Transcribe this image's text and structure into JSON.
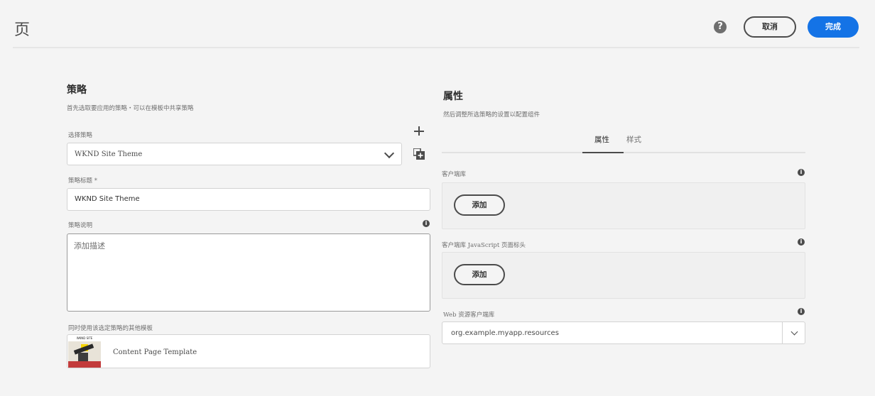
{
  "header": {
    "title": "页",
    "help_icon": "help-icon",
    "help_glyph": "?",
    "cancel_label": "取消",
    "done_label": "完成",
    "accent_color": "#1473e6"
  },
  "policy": {
    "title": "策略",
    "subtitle": "首先选取要应用的策略・可以在模板中共享策略",
    "select_label": "选择策略",
    "select_value": "WKND Site Theme",
    "policy_title_label": "策略标题 *",
    "policy_title_value": "WKND Site Theme",
    "description_label": "策略说明",
    "description_placeholder": "添加描述",
    "other_templates_label": "同时使用该选定策略的其他模板",
    "template_name": "Content Page Template",
    "thumb_text": "WKND SITE"
  },
  "properties": {
    "title": "属性",
    "subtitle": "然后调整所选策略的设置以配置组件",
    "tabs": [
      {
        "label": "属性",
        "active": true
      },
      {
        "label": "样式",
        "active": false
      }
    ],
    "client_lib_label": "客户端库",
    "client_lib_add": "添加",
    "client_lib_js_label": "客户端库 JavaScript 页面标头",
    "client_lib_js_add": "添加",
    "web_lib_label": "Web 资源客户端库",
    "web_lib_value": "org.example.myapp.resources",
    "info_glyph": "i"
  }
}
